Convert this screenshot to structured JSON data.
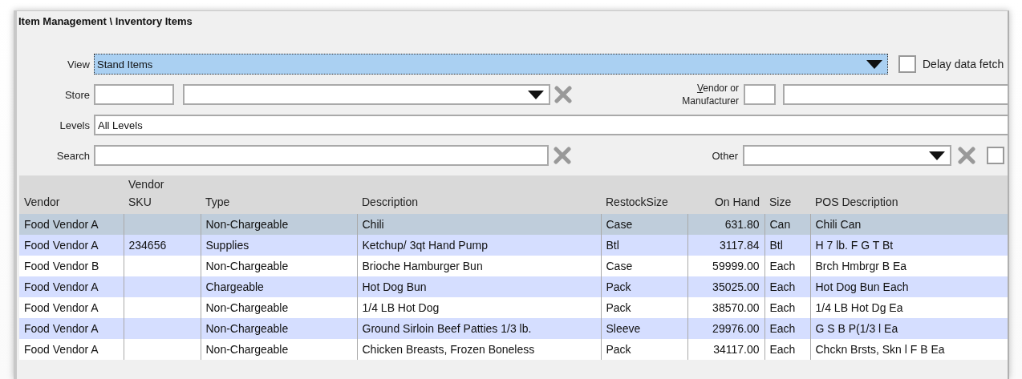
{
  "window": {
    "title": "Item Management \\ Inventory Items"
  },
  "filters": {
    "view": {
      "label": "View",
      "value": "Stand Items",
      "focused": true
    },
    "delay_fetch": {
      "label": "Delay data fetch",
      "checked": false
    },
    "store": {
      "label": "Store"
    },
    "vendor": {
      "label": "Vendor or Manufacturer"
    },
    "levels": {
      "label": "Levels",
      "value": "All Levels"
    },
    "search": {
      "label": "Search"
    },
    "other": {
      "label": "Other",
      "checked": false
    }
  },
  "table": {
    "columns": [
      "Vendor",
      "Vendor SKU",
      "Type",
      "Description",
      "RestockSize",
      "On Hand",
      "Size",
      "POS Description"
    ],
    "rows": [
      {
        "selected": true,
        "cells": [
          "Food Vendor A",
          "",
          "Non-Chargeable",
          "Chili",
          "Case",
          "631.80",
          "Can",
          "Chili Can"
        ]
      },
      {
        "selected": false,
        "cells": [
          "Food Vendor A",
          "234656",
          "Supplies",
          "Ketchup/ 3qt Hand Pump",
          "Btl",
          "3117.84",
          "Btl",
          "H 7 lb. F G T Bt"
        ]
      },
      {
        "selected": false,
        "cells": [
          "Food Vendor B",
          "",
          "Non-Chargeable",
          "Brioche Hamburger Bun",
          "Case",
          "59999.00",
          "Each",
          "Brch Hmbrgr B Ea"
        ]
      },
      {
        "selected": false,
        "cells": [
          "Food Vendor A",
          "",
          "Chargeable",
          "Hot Dog Bun",
          "Pack",
          "35025.00",
          "Each",
          "Hot Dog Bun Each"
        ]
      },
      {
        "selected": false,
        "cells": [
          "Food Vendor A",
          "",
          "Non-Chargeable",
          "1/4 LB Hot Dog",
          "Pack",
          "38570.00",
          "Each",
          "1/4 LB Hot Dg Ea"
        ]
      },
      {
        "selected": false,
        "cells": [
          "Food Vendor A",
          "",
          "Non-Chargeable",
          "Ground Sirloin Beef Patties 1/3 lb.",
          "Sleeve",
          "29976.00",
          "Each",
          "G S B P(1/3 l Ea"
        ]
      },
      {
        "selected": false,
        "cells": [
          "Food Vendor A",
          "",
          "Non-Chargeable",
          "Chicken Breasts, Frozen Boneless",
          "Pack",
          "34117.00",
          "Each",
          "Chckn Brsts, Skn l F B Ea"
        ]
      }
    ]
  }
}
